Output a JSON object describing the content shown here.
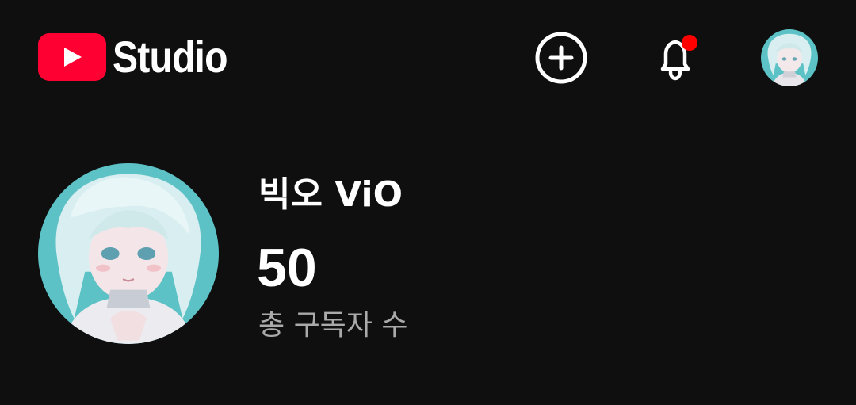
{
  "header": {
    "logo_text": "Studio",
    "brand_color": "#ff0033",
    "create_icon": "add-circle-icon",
    "notifications_icon": "bell-icon",
    "notification_dot_color": "#ff0000",
    "account_icon": "account-avatar"
  },
  "channel": {
    "name": "빅오 ViO",
    "subscriber_count": "50",
    "subscriber_label": "총 구독자 수"
  },
  "colors": {
    "background": "#0f0f0f",
    "text_primary": "#ffffff",
    "text_secondary": "#aaaaaa"
  }
}
